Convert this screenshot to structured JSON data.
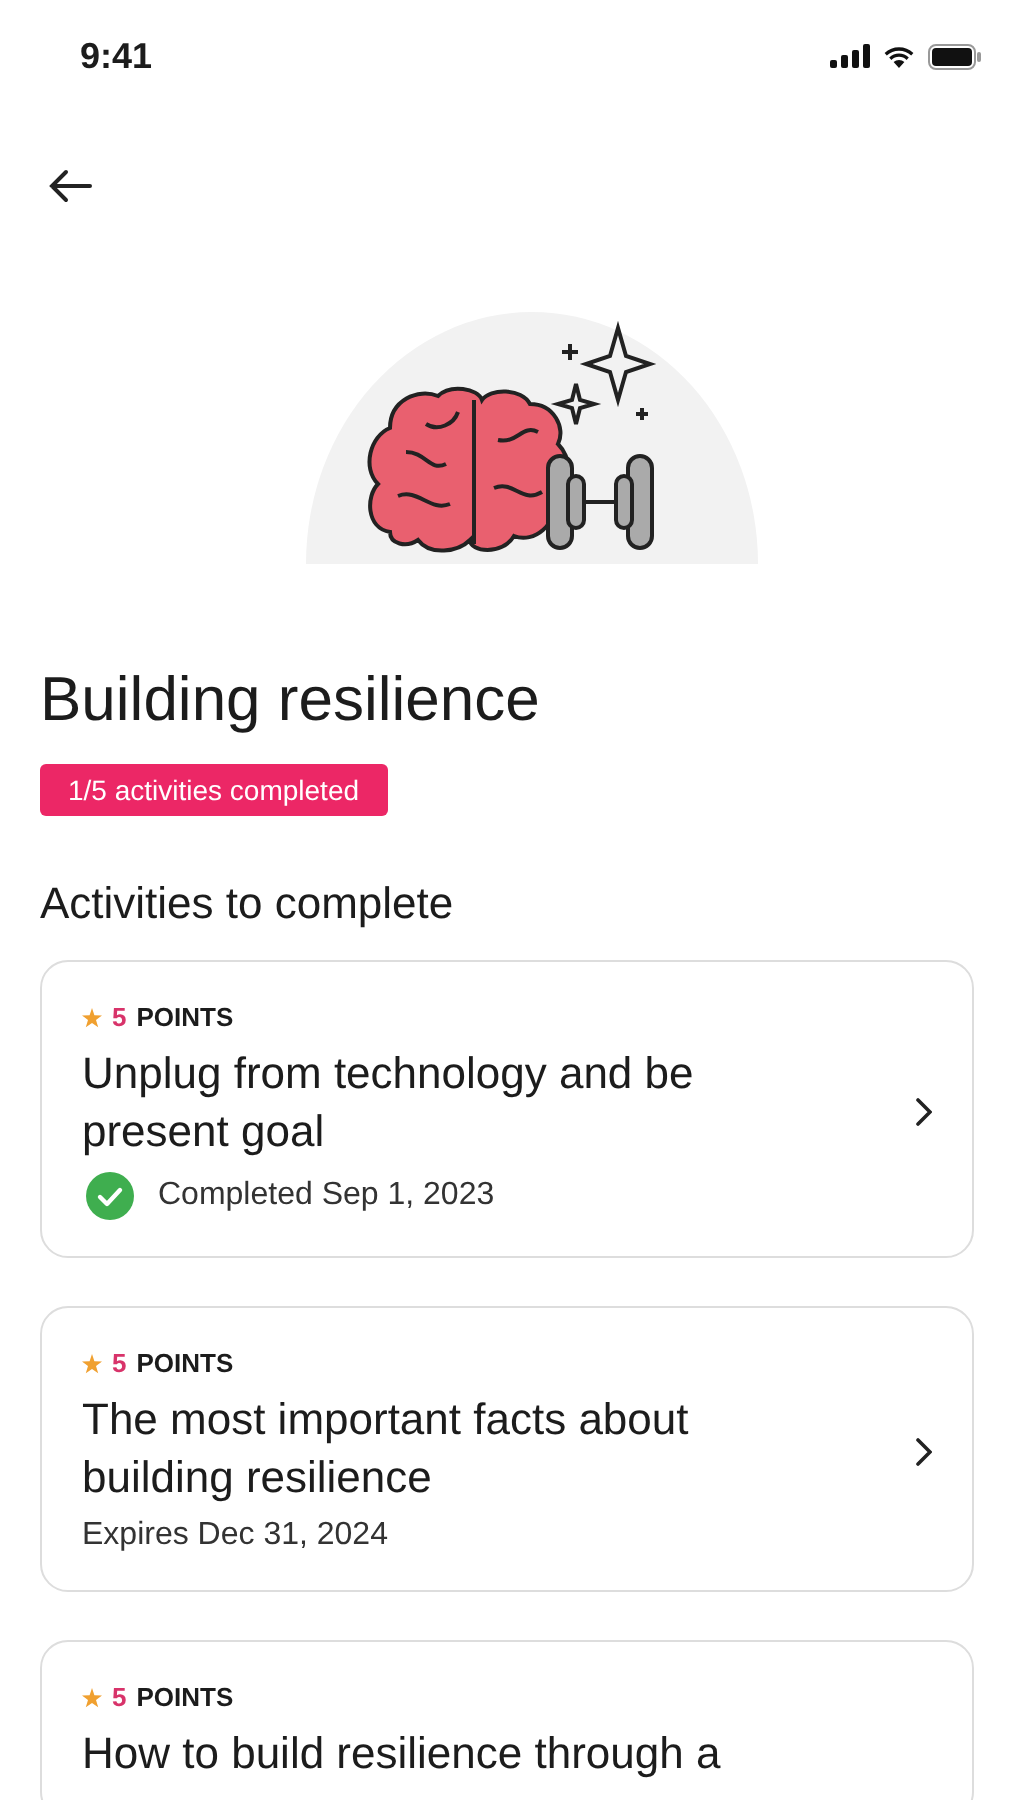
{
  "status_bar": {
    "time": "9:41"
  },
  "title": "Building resilience",
  "progress_badge": "1/5 activities completed",
  "section_title": "Activities to complete",
  "activities": [
    {
      "points": "5",
      "points_label": "POINTS",
      "title": "Unplug from technology and be present goal",
      "kind": "completed",
      "status": "Completed Sep 1, 2023"
    },
    {
      "points": "5",
      "points_label": "POINTS",
      "title": "The most important facts about building resilience",
      "kind": "expires",
      "status": "Expires Dec 31, 2024"
    },
    {
      "points": "5",
      "points_label": "POINTS",
      "title": "How to build resilience through a"
    }
  ]
}
